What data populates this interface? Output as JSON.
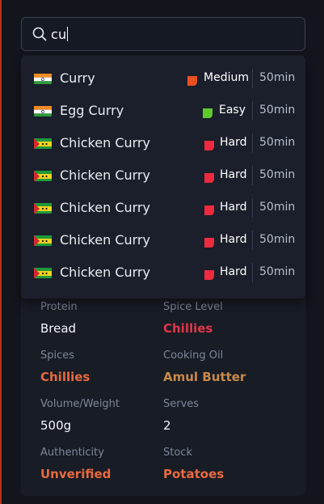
{
  "colors": {
    "accent_red": "#e0374a",
    "accent_orange": "#e86a3f",
    "accent_amber": "#c98a4b",
    "difficulty_medium": "#e8501f",
    "difficulty_easy": "#5ecb2a",
    "difficulty_hard": "#ee2a3f"
  },
  "search": {
    "icon": "search-icon",
    "value": "cu"
  },
  "results": [
    {
      "flag": "india-flag",
      "name": "Curry",
      "difficulty": "Medium",
      "difficulty_icon": "difficulty-flag-icon",
      "duration": "50min"
    },
    {
      "flag": "india-flag",
      "name": "Egg Curry",
      "difficulty": "Easy",
      "difficulty_icon": "difficulty-flag-icon",
      "duration": "50min"
    },
    {
      "flag": "sao-tome-flag",
      "name": "Chicken Curry",
      "difficulty": "Hard",
      "difficulty_icon": "difficulty-flag-icon",
      "duration": "50min"
    },
    {
      "flag": "sao-tome-flag",
      "name": "Chicken Curry",
      "difficulty": "Hard",
      "difficulty_icon": "difficulty-flag-icon",
      "duration": "50min"
    },
    {
      "flag": "sao-tome-flag",
      "name": "Chicken Curry",
      "difficulty": "Hard",
      "difficulty_icon": "difficulty-flag-icon",
      "duration": "50min"
    },
    {
      "flag": "sao-tome-flag",
      "name": "Chicken Curry",
      "difficulty": "Hard",
      "difficulty_icon": "difficulty-flag-icon",
      "duration": "50min"
    },
    {
      "flag": "sao-tome-flag",
      "name": "Chicken Curry",
      "difficulty": "Hard",
      "difficulty_icon": "difficulty-flag-icon",
      "duration": "50min"
    }
  ],
  "details": {
    "protein": {
      "label": "Protein",
      "value": "Bread"
    },
    "spice_level": {
      "label": "Spice Level",
      "value": "Chillies"
    },
    "spices": {
      "label": "Spices",
      "value": "Chillies"
    },
    "cooking_oil": {
      "label": "Cooking Oil",
      "value": "Amul Butter"
    },
    "volume_weight": {
      "label": "Volume/Weight",
      "value": "500g"
    },
    "serves": {
      "label": "Serves",
      "value": "2"
    },
    "authenticity": {
      "label": "Authenticity",
      "value": "Unverified"
    },
    "stock": {
      "label": "Stock",
      "value": "Potatoes"
    }
  }
}
